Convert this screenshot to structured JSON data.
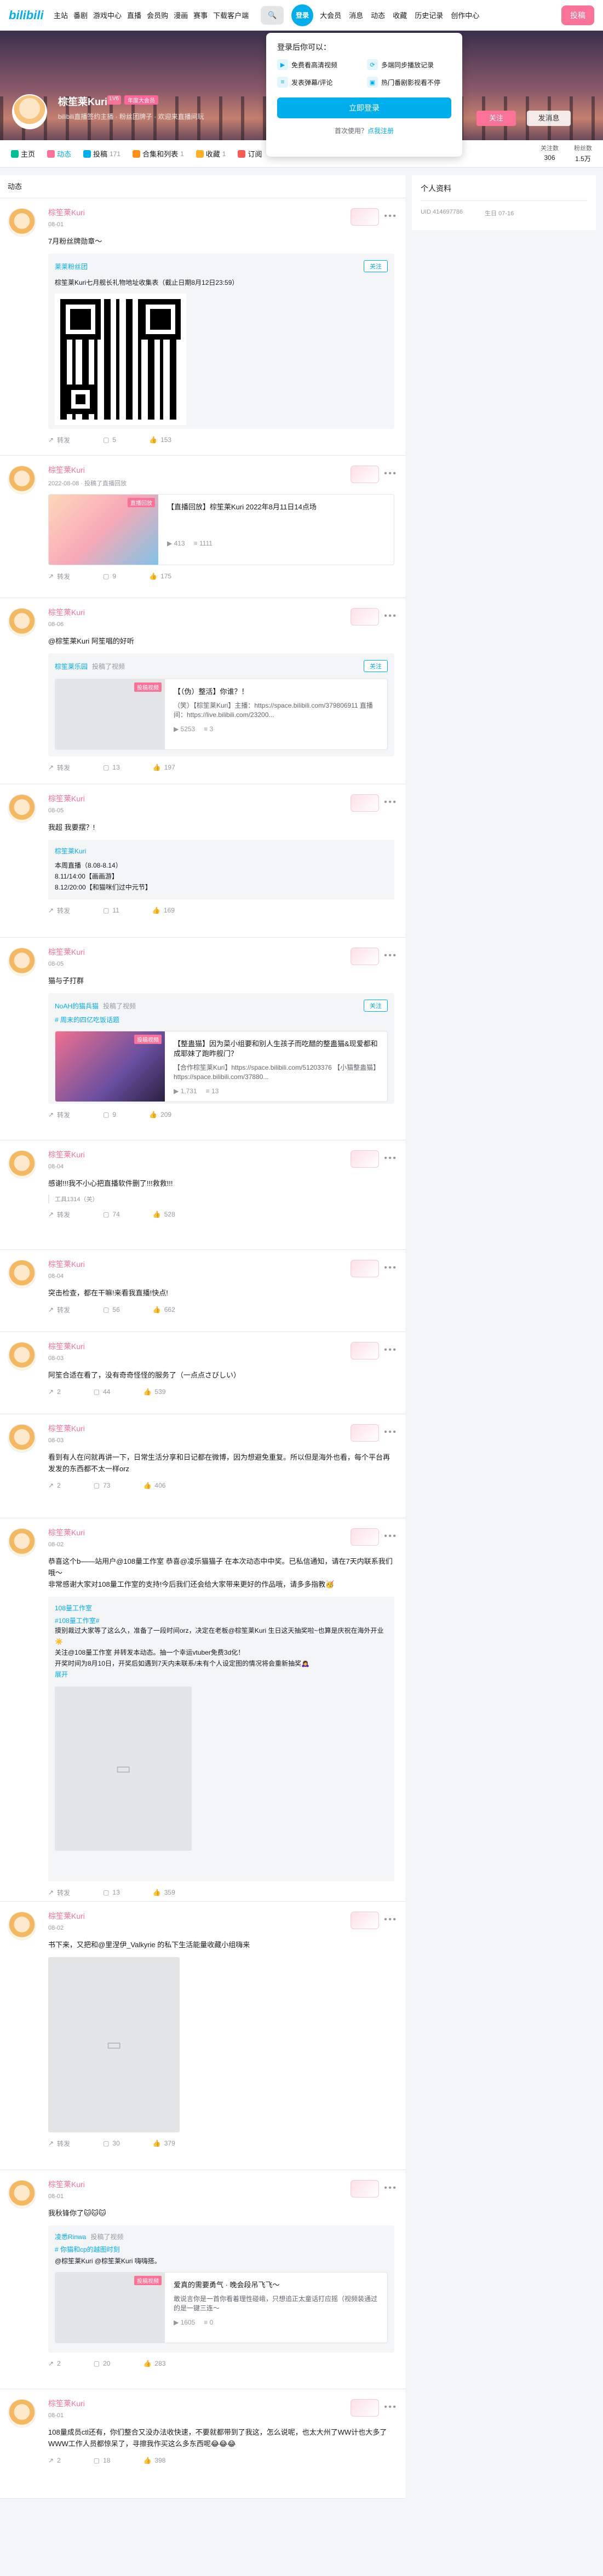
{
  "nav": {
    "logo": "bilibili",
    "left_items": [
      "主站",
      "番剧",
      "游戏中心",
      "直播",
      "会员购",
      "漫画",
      "赛事",
      "下载客户端"
    ],
    "login": "登录",
    "right_items": [
      "大会员",
      "消息",
      "动态",
      "收藏",
      "历史记录",
      "创作中心"
    ],
    "post": "投稿"
  },
  "popup": {
    "title": "登录后你可以：",
    "features": [
      "免费看高清视频",
      "多端同步播放记录",
      "发表弹幕/评论",
      "热门番剧影视看不停"
    ],
    "login_button": "立即登录",
    "first_use": "首次使用？",
    "register": "点我注册"
  },
  "profile": {
    "name": "棕笙莱Kuri",
    "level": "LV6",
    "tag": "年度大会员",
    "sign": "bilibili直播签约主播 · 粉丝团牌子 · 欢迎来直播间玩",
    "follow": "关注",
    "message": "发消息"
  },
  "tabs": [
    {
      "label": "主页",
      "count": ""
    },
    {
      "label": "动态",
      "count": ""
    },
    {
      "label": "投稿",
      "count": "171"
    },
    {
      "label": "合集和列表",
      "count": "1"
    },
    {
      "label": "收藏",
      "count": "1"
    },
    {
      "label": "订阅",
      "count": ""
    }
  ],
  "stats": {
    "following_label": "关注数",
    "following": "306",
    "fans_label": "粉丝数",
    "fans": "1.5万"
  },
  "sidebar": {
    "title": "个人资料",
    "uid": "UID 414697786",
    "birthday": "生日 07-16"
  },
  "feed_title": "动态",
  "posts": [
    {
      "name": "棕笙莱Kuri",
      "time": "08-01",
      "text": "7月粉丝牌勋章～",
      "box_name": "莱莱粉丝团",
      "box_follow": "关注",
      "box_text": "棕笙莱Kuri七月舰长礼物地址收集表（截止日期8月12日23:59）",
      "share": "转发",
      "comment": "5",
      "like": "153"
    },
    {
      "name": "棕笙莱Kuri",
      "time": "2022-08-08 · 投稿了直播回放",
      "card_title": "【直播回放】棕笙莱Kuri 2022年8月11日14点场",
      "card_badge": "直播回放",
      "card_play": "413",
      "card_danmaku": "1111",
      "share": "转发",
      "comment": "9",
      "like": "175"
    },
    {
      "name": "棕笙莱Kuri",
      "time": "08-06",
      "text": "@棕笙莱Kuri 阿笙唱的好听",
      "box_name": "棕笙莱乐园",
      "box_sub": "投稿了视频",
      "box_follow": "关注",
      "card_title": "【（伪）整活】你谁？！",
      "card_desc": "（笑）【棕笙莱Kuri】主播：https://space.bilibili.com/379806911 直播间：https://live.bilibili.com/23200...",
      "card_badge": "投稿视频",
      "card_play": "5253",
      "card_danmaku": "3",
      "share": "转发",
      "comment": "13",
      "like": "197"
    },
    {
      "name": "棕笙莱Kuri",
      "time": "08-05",
      "text": "我超 我要摆？!",
      "box_name": "棕笙莱Kuri",
      "box_lines": [
        "本周直播（8.08-8.14）",
        "8.11/14:00【画画游】",
        "8.12/20:00【和猫咪们过中元节】"
      ],
      "share": "转发",
      "comment": "11",
      "like": "169"
    },
    {
      "name": "棕笙莱Kuri",
      "time": "08-05",
      "text": "猫与子打群",
      "box_name": "NoAH的猫兵猫",
      "box_sub": "投稿了视频",
      "box_follow": "关注",
      "box_topic": "# 周末的四亿吃饭话题",
      "card_title": "【整蛊猫】因为菜小组要和别人生孩子而吃醋的整蛊猫&现爱都和成耶妹了跑昨舰门？",
      "card_desc": "【合作棕笙莱Kuri】https://space.bilibili.com/51203376 【小猫整蛊猫】https://space.bilibili.com/37880...",
      "card_badge": "投稿视频",
      "card_play": "1,731",
      "card_danmaku": "13",
      "share": "转发",
      "comment": "9",
      "like": "209"
    },
    {
      "name": "棕笙莱Kuri",
      "time": "08-04",
      "text": "感谢!!!我不小心把直播软件删了!!!救救!!!",
      "quote": "工具1314（关）",
      "share": "转发",
      "comment": "74",
      "like": "528"
    },
    {
      "name": "棕笙莱Kuri",
      "time": "08-04",
      "text": "突击检查，都在干嘛!来看我直播!快点!",
      "share": "转发",
      "comment": "56",
      "like": "662"
    },
    {
      "name": "棕笙莱Kuri",
      "time": "08-03",
      "text": "阿笙合适在看了，没有奇奇怪怪的服务了（一点点さびしい）",
      "share": "2",
      "comment": "44",
      "like": "539"
    },
    {
      "name": "棕笙莱Kuri",
      "time": "08-03",
      "text": "看到有人在问就再讲一下，日常生活分享和日记都在微博，因为想避免重复。所以但是海外也看，每个平台再发发的东西都不太一样orz",
      "share": "2",
      "comment": "73",
      "like": "406"
    },
    {
      "name": "棕笙莱Kuri",
      "time": "08-02",
      "text": "恭喜这个b——站用户@108量工作室 恭喜@凌乐猫猫子 在本次动态中中奖。已私信通知，请在7天内联系我们哦～\n非常感谢大家对108量工作室的支持!今后我们还会给大家带来更好的作品哦，请多多指教🥳",
      "box_name": "108量工作室",
      "box_topic": "#108量工作室#",
      "box_lines": [
        "摸别裁过大家等了这么久，准备了一段时间orz，决定在老板@棕笙莱Kuri 生日这天抽奖啦~也算是庆祝在海外开业☀️",
        "关注@108量工作室 并转发本动态。抽一个幸运vtuber免费3d化！",
        "开奖时间为8月10日，开奖后如遇到7天内未联系/未有个人设定图的情况将会重新抽奖🙇‍♀️"
      ],
      "box_expand": "展开",
      "share": "转发",
      "comment": "13",
      "like": "359"
    },
    {
      "name": "棕笙莱Kuri",
      "time": "08-02",
      "text": "书下来，又把和@里涅伊_Valkyrie 的私下生活能量收藏小组嗨来",
      "share": "转发",
      "comment": "30",
      "like": "379"
    },
    {
      "name": "棕笙莱Kuri",
      "time": "08-01",
      "text": "我秋锋你了🐱🐱🐱",
      "box_name": "凌悉Rinwa",
      "box_sub": "投稿了视频",
      "box_topic": "# 你猫和cp的越图时刻",
      "box_lines": [
        "@棕笙莱Kuri @棕笙莱Kuri 嗨嗨搭。"
      ],
      "card_title": "爱真的需要勇气 · 晚会段吊飞飞～",
      "card_desc": "敢说言你是一首你看着理性碰峨，只想追正太童话打应摇（视频装通过的是一键三连～",
      "card_badge": "投稿视频",
      "card_play": "1605",
      "card_danmaku": "0",
      "share": "2",
      "comment": "20",
      "like": "283"
    },
    {
      "name": "棕笙莱Kuri",
      "time": "08-01",
      "text": "108量成员ctl还有，你们整合又没办法收快速，不要就都带到了我这，怎么说呢，也太大州了WW计也大多了WWW工作人员都惊呆了，寻擦我作买这么多东西呢😂😂😂",
      "share": "2",
      "comment": "18",
      "like": "398"
    }
  ],
  "colors": {
    "accent": "#00aeec",
    "pink": "#fb7299"
  },
  "icons": {
    "search": "search-icon",
    "more": "more-dots-icon",
    "share": "share-icon",
    "comment": "comment-icon",
    "like": "like-icon"
  }
}
